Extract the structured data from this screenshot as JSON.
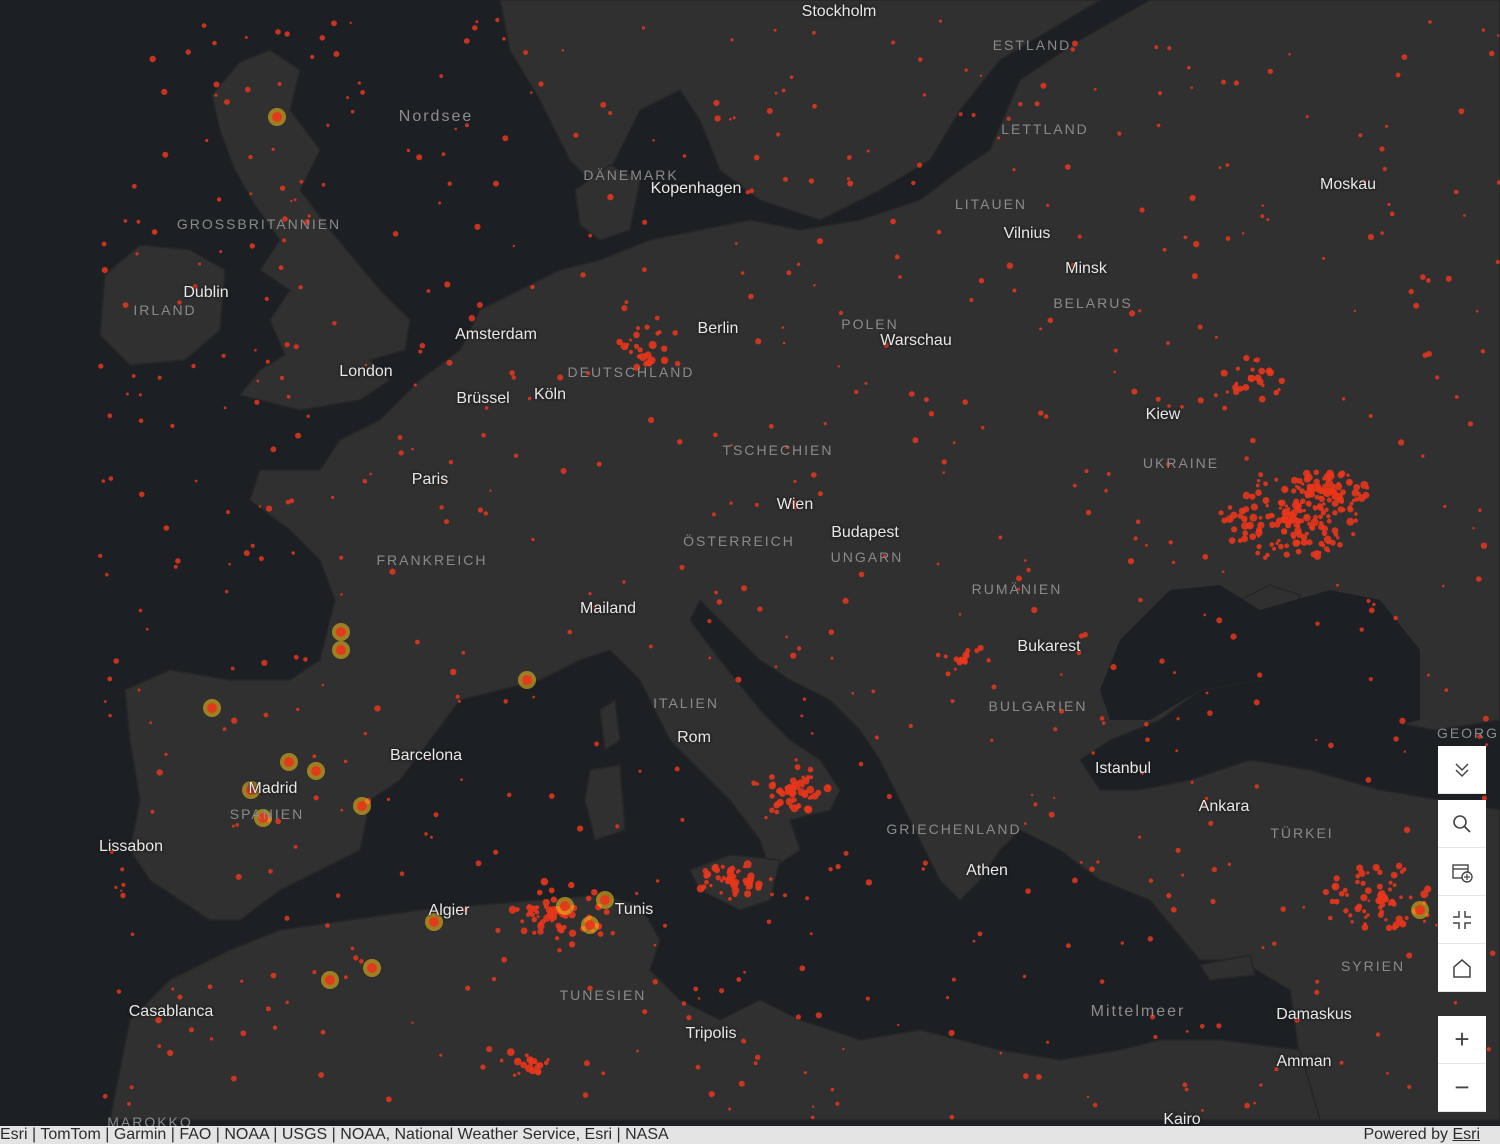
{
  "map": {
    "background_color": "#1c2024",
    "land_color": "#303030",
    "marker_color": "#e8361c",
    "highlight_color": "#f5c518",
    "cities": [
      {
        "name": "Stockholm"
      },
      {
        "name": "Kopenhagen"
      },
      {
        "name": "Dublin"
      },
      {
        "name": "Amsterdam"
      },
      {
        "name": "Berlin"
      },
      {
        "name": "London"
      },
      {
        "name": "Brüssel"
      },
      {
        "name": "Köln"
      },
      {
        "name": "Paris"
      },
      {
        "name": "Warschau"
      },
      {
        "name": "Vilnius"
      },
      {
        "name": "Minsk"
      },
      {
        "name": "Moskau"
      },
      {
        "name": "Kiew"
      },
      {
        "name": "Wien"
      },
      {
        "name": "Budapest"
      },
      {
        "name": "Mailand"
      },
      {
        "name": "Bukarest"
      },
      {
        "name": "Barcelona"
      },
      {
        "name": "Madrid"
      },
      {
        "name": "Rom"
      },
      {
        "name": "Lissabon"
      },
      {
        "name": "Istanbul"
      },
      {
        "name": "Ankara"
      },
      {
        "name": "Algier"
      },
      {
        "name": "Tunis"
      },
      {
        "name": "Athen"
      },
      {
        "name": "Casablanca"
      },
      {
        "name": "Tripolis"
      },
      {
        "name": "Damaskus"
      },
      {
        "name": "Amman"
      },
      {
        "name": "Kairo"
      }
    ],
    "countries": [
      {
        "name": "ESTLAND"
      },
      {
        "name": "LETTLAND"
      },
      {
        "name": "DÄNEMARK"
      },
      {
        "name": "GROSSBRITANNIEN"
      },
      {
        "name": "IRLAND"
      },
      {
        "name": "LITAUEN"
      },
      {
        "name": "BELARUS"
      },
      {
        "name": "POLEN"
      },
      {
        "name": "DEUTSCHLAND"
      },
      {
        "name": "TSCHECHIEN"
      },
      {
        "name": "UKRAINE"
      },
      {
        "name": "FRANKREICH"
      },
      {
        "name": "ÖSTERREICH"
      },
      {
        "name": "UNGARN"
      },
      {
        "name": "RUMÄNIEN"
      },
      {
        "name": "ITALIEN"
      },
      {
        "name": "BULGARIEN"
      },
      {
        "name": "SPANIEN"
      },
      {
        "name": "GRIECHENLAND"
      },
      {
        "name": "TÜRKEI"
      },
      {
        "name": "SYRIEN"
      },
      {
        "name": "TUNESIEN"
      },
      {
        "name": "MAROKKO"
      },
      {
        "name": "GEORG"
      }
    ],
    "seas": [
      {
        "name": "Nordsee"
      },
      {
        "name": "Mittelmeer"
      }
    ]
  },
  "controls": {
    "collapse": "chevron-double-down-icon",
    "search": "search-icon",
    "layers": "layer-list-icon",
    "fullscreen": "exit-fullscreen-icon",
    "home": "home-icon",
    "zoom_in": "+",
    "zoom_out": "−"
  },
  "attribution": {
    "text": "Esri | TomTom | Garmin | FAO | NOAA | USGS | NOAA, National Weather Service, Esri | NASA",
    "powered_by": "Powered by ",
    "powered_by_link": "Esri"
  }
}
